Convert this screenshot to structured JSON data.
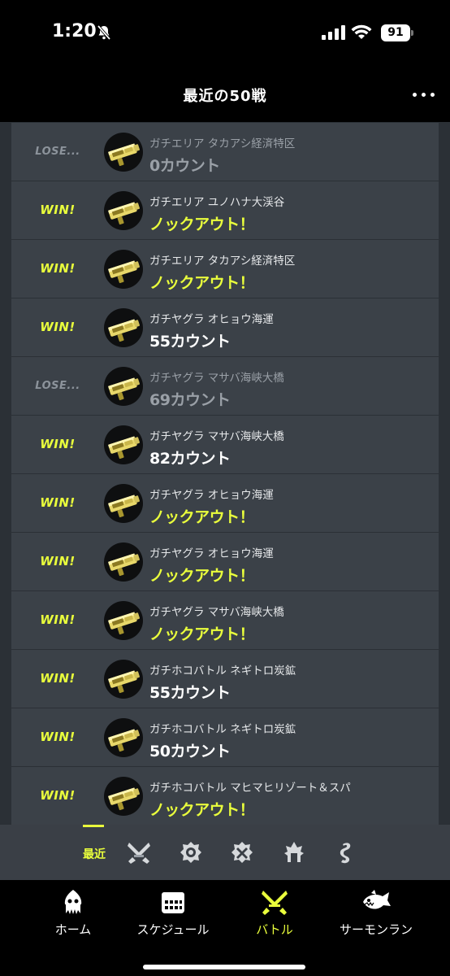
{
  "status_bar": {
    "time": "1:20",
    "battery": "91"
  },
  "header": {
    "title": "最近の50戦"
  },
  "battles": [
    {
      "result": "LOSE...",
      "outcome": "lose",
      "stage": "ガチエリア タカアシ経済特区",
      "score": "0カウント",
      "score_type": "count"
    },
    {
      "result": "WIN!",
      "outcome": "win",
      "stage": "ガチエリア ユノハナ大渓谷",
      "score": "ノックアウト！",
      "score_type": "ko"
    },
    {
      "result": "WIN!",
      "outcome": "win",
      "stage": "ガチエリア タカアシ経済特区",
      "score": "ノックアウト！",
      "score_type": "ko"
    },
    {
      "result": "WIN!",
      "outcome": "win",
      "stage": "ガチヤグラ オヒョウ海運",
      "score": "55カウント",
      "score_type": "count"
    },
    {
      "result": "LOSE...",
      "outcome": "lose",
      "stage": "ガチヤグラ マサバ海峡大橋",
      "score": "69カウント",
      "score_type": "count"
    },
    {
      "result": "WIN!",
      "outcome": "win",
      "stage": "ガチヤグラ マサバ海峡大橋",
      "score": "82カウント",
      "score_type": "count"
    },
    {
      "result": "WIN!",
      "outcome": "win",
      "stage": "ガチヤグラ オヒョウ海運",
      "score": "ノックアウト！",
      "score_type": "ko"
    },
    {
      "result": "WIN!",
      "outcome": "win",
      "stage": "ガチヤグラ オヒョウ海運",
      "score": "ノックアウト！",
      "score_type": "ko"
    },
    {
      "result": "WIN!",
      "outcome": "win",
      "stage": "ガチヤグラ マサバ海峡大橋",
      "score": "ノックアウト！",
      "score_type": "ko"
    },
    {
      "result": "WIN!",
      "outcome": "win",
      "stage": "ガチホコバトル ネギトロ炭鉱",
      "score": "55カウント",
      "score_type": "count"
    },
    {
      "result": "WIN!",
      "outcome": "win",
      "stage": "ガチホコバトル ネギトロ炭鉱",
      "score": "50カウント",
      "score_type": "count"
    },
    {
      "result": "WIN!",
      "outcome": "win",
      "stage": "ガチホコバトル マヒマヒリゾート＆スパ",
      "score": "ノックアウト！",
      "score_type": "ko"
    }
  ],
  "filter": {
    "active_label": "最近",
    "icons": [
      "regular-battle-icon",
      "bankara-battle-icon",
      "x-battle-icon",
      "event-match-icon",
      "private-battle-icon"
    ]
  },
  "tabs": [
    {
      "label": "ホーム",
      "icon": "squid-icon",
      "active": false
    },
    {
      "label": "スケジュール",
      "icon": "calendar-icon",
      "active": false
    },
    {
      "label": "バトル",
      "icon": "battle-icon",
      "active": true
    },
    {
      "label": "サーモンラン",
      "icon": "salmon-icon",
      "active": false
    }
  ],
  "colors": {
    "accent": "#eaff3c",
    "row": "#3b4148",
    "background": "#2b3036",
    "lose": "#8c939b"
  }
}
